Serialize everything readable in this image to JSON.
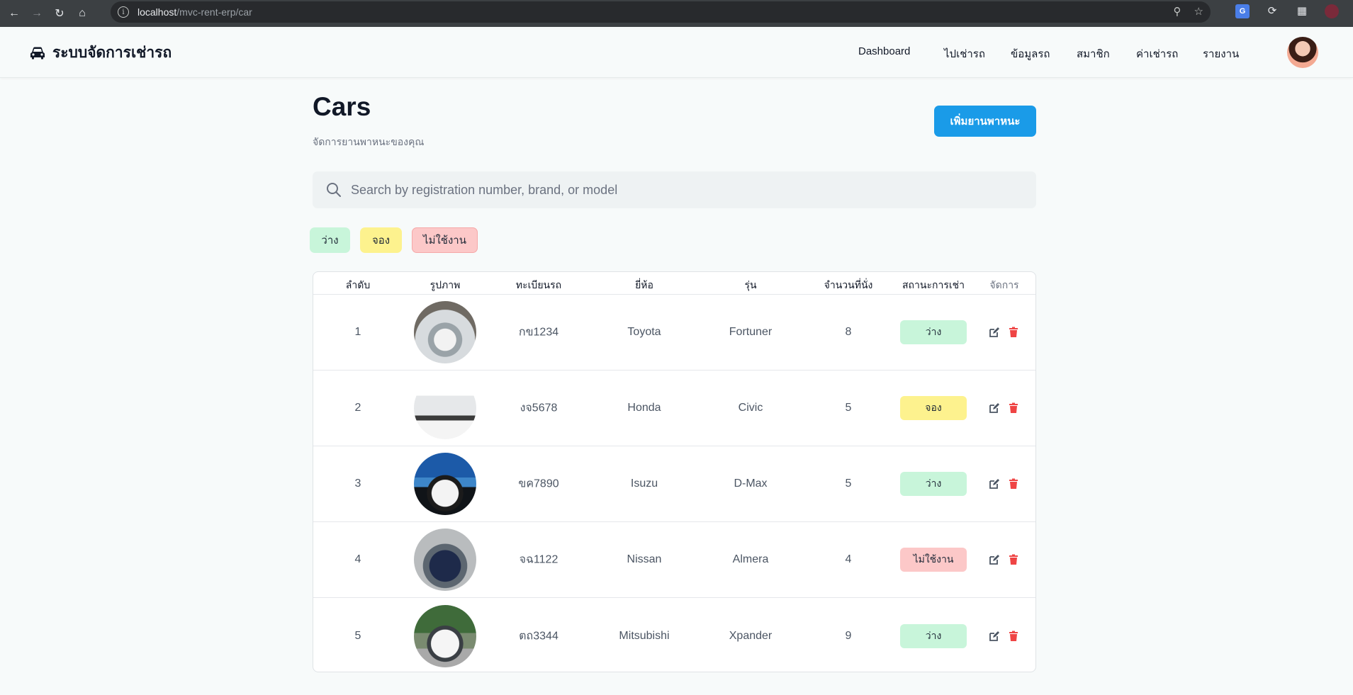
{
  "browser": {
    "url_host": "localhost",
    "url_path": "/mvc-rent-erp/car"
  },
  "navbar": {
    "brand": "ระบบจัดการเช่ารถ",
    "links": [
      "Dashboard",
      "ไปเช่ารถ",
      "ข้อมูลรถ",
      "สมาชิก",
      "ค่าเช่ารถ",
      "รายงาน"
    ]
  },
  "page": {
    "title": "Cars",
    "subtitle": "จัดการยานพาหนะของคุณ",
    "add_button": "เพิ่มยานพาหนะ"
  },
  "search": {
    "placeholder": "Search by registration number, brand, or model"
  },
  "filters": {
    "available": "ว่าง",
    "booked": "จอง",
    "inactive": "ไม่ใช้งาน"
  },
  "table": {
    "headers": [
      "ลำดับ",
      "รูปภาพ",
      "ทะเบียนรถ",
      "ยี่ห้อ",
      "รุ่น",
      "จำนวนที่นั่ง",
      "สถานะการเช่า",
      "จัดการ"
    ],
    "rows": [
      {
        "no": "1",
        "plate": "กข1234",
        "brand": "Toyota",
        "model": "Fortuner",
        "seats": "8",
        "status": "ว่าง"
      },
      {
        "no": "2",
        "plate": "งจ5678",
        "brand": "Honda",
        "model": "Civic",
        "seats": "5",
        "status": "จอง"
      },
      {
        "no": "3",
        "plate": "ขค7890",
        "brand": "Isuzu",
        "model": "D-Max",
        "seats": "5",
        "status": "ว่าง"
      },
      {
        "no": "4",
        "plate": "จฉ1122",
        "brand": "Nissan",
        "model": "Almera",
        "seats": "4",
        "status": "ไม่ใช้งาน"
      },
      {
        "no": "5",
        "plate": "ตถ3344",
        "brand": "Mitsubishi",
        "model": "Xpander",
        "seats": "9",
        "status": "ว่าง"
      }
    ]
  },
  "colors": {
    "primary": "#1a9be8",
    "status_available": "#c8f5da",
    "status_booked": "#fdf28e",
    "status_inactive": "#fcc8c8",
    "edit_icon": "#4b5563",
    "delete_icon": "#ef4444"
  }
}
